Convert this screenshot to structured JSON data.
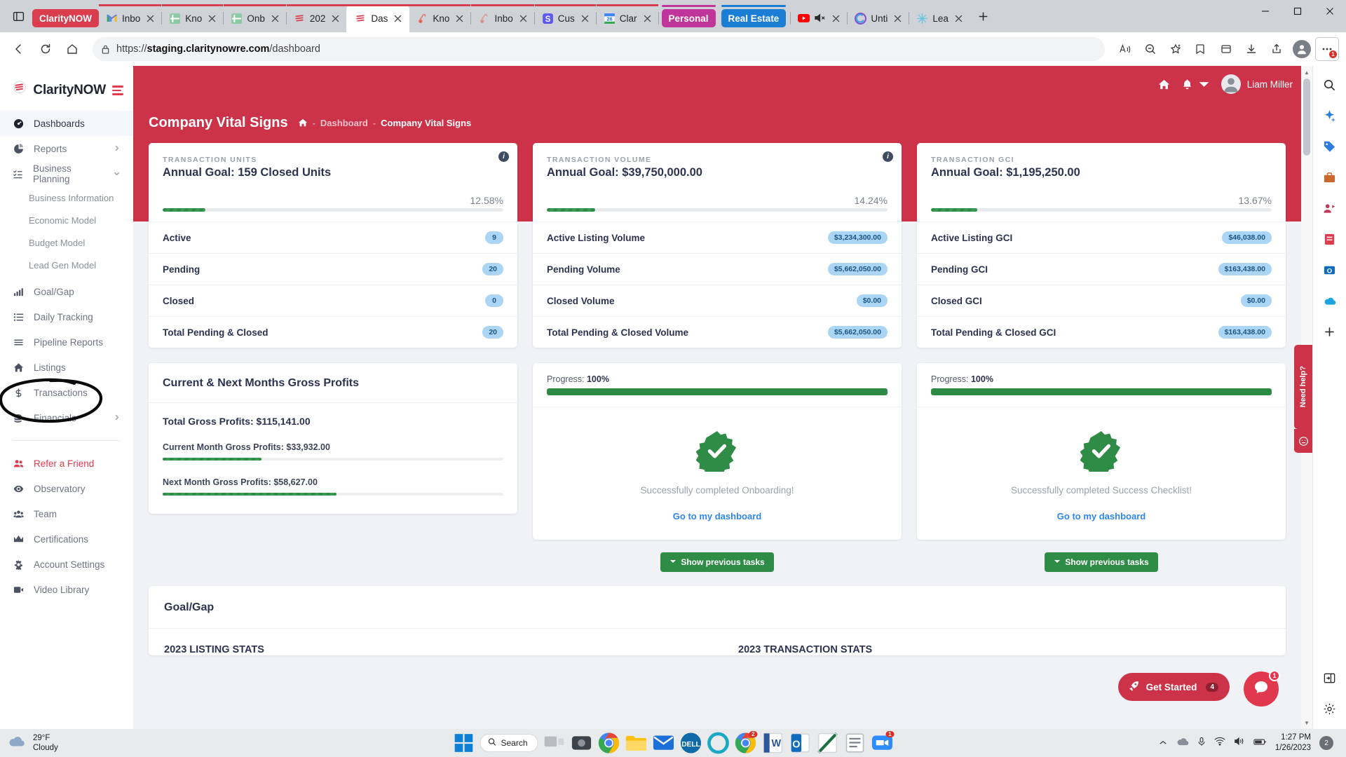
{
  "browser": {
    "tabs": [
      {
        "id": "claritynow-group",
        "label": "ClarityNOW",
        "type": "group-pill",
        "color": "#d93d4e"
      },
      {
        "id": "gmail",
        "label": "Inbo",
        "icon": "gmail-icon",
        "line": "#d93d4e"
      },
      {
        "id": "kno1",
        "label": "Kno",
        "icon": "sheets-icon",
        "line": "#d93d4e"
      },
      {
        "id": "onb",
        "label": "Onb",
        "icon": "sheets-icon",
        "line": "#d93d4e"
      },
      {
        "id": "2023",
        "label": "202",
        "icon": "claritynow-icon",
        "line": "#d93d4e"
      },
      {
        "id": "dashboard",
        "label": "Das",
        "icon": "claritynow-icon",
        "active": true,
        "line": "#d93d4e"
      },
      {
        "id": "kno2",
        "label": "Kno",
        "icon": "pipedrive-icon",
        "line": "#d93d4e"
      },
      {
        "id": "inbox2",
        "label": "Inbo",
        "icon": "pipedrive-icon",
        "line": "#d93d4e"
      },
      {
        "id": "cus",
        "label": "Cus",
        "icon": "s-icon",
        "line": "#d93d4e"
      },
      {
        "id": "clar",
        "label": "Clar",
        "icon": "calendar-26-icon",
        "line": "#d93d4e"
      },
      {
        "id": "personal",
        "label": "Personal",
        "type": "group-pill",
        "color": "#c0359a"
      },
      {
        "id": "realestate",
        "label": "Real Estate",
        "type": "group-pill",
        "color": "#1a7fd4"
      },
      {
        "id": "youtube",
        "label": "",
        "icon": "youtube-icon",
        "muted": true
      },
      {
        "id": "unti",
        "label": "Unti",
        "icon": "copilot-icon"
      },
      {
        "id": "lea",
        "label": "Lea",
        "icon": "sparkle-icon"
      }
    ],
    "new_tab_label": "+",
    "address": {
      "url_prefix": "https://",
      "url_domain": "staging.claritynowre.com",
      "url_path": "/dashboard"
    },
    "toolbar_icons": [
      "back-icon",
      "refresh-icon",
      "home-icon",
      "lock-icon",
      "read-aloud-icon",
      "zoom-out-icon",
      "collections-add-icon",
      "favorites-icon",
      "collections-icon",
      "downloads-icon",
      "share-icon",
      "profile-icon",
      "settings-more-icon"
    ],
    "more_badge": "1",
    "window_controls": [
      "minimize-icon",
      "maximize-icon",
      "close-icon"
    ]
  },
  "sidebar": {
    "brand": "ClarityNOW",
    "items": [
      {
        "label": "Dashboards",
        "icon": "dashboard-icon",
        "active": true
      },
      {
        "label": "Reports",
        "icon": "pie-chart-icon",
        "chevron": true
      },
      {
        "label": "Business Planning",
        "icon": "list-check-icon",
        "chevron": true,
        "expanded": true
      },
      {
        "label": "Business Information",
        "sub": true
      },
      {
        "label": "Economic Model",
        "sub": true
      },
      {
        "label": "Budget Model",
        "sub": true
      },
      {
        "label": "Lead Gen Model",
        "sub": true
      },
      {
        "label": "Goal/Gap",
        "icon": "bar-chart-icon"
      },
      {
        "label": "Daily Tracking",
        "icon": "list-icon"
      },
      {
        "label": "Pipeline Reports",
        "icon": "lines-icon"
      },
      {
        "label": "Listings",
        "icon": "home-icon",
        "annotated": true
      },
      {
        "label": "Transactions",
        "icon": "dollar-icon"
      },
      {
        "label": "Financials",
        "icon": "coins-icon",
        "chevron": true
      },
      {
        "label": "Refer a Friend",
        "icon": "people-icon",
        "accent": true
      },
      {
        "label": "Observatory",
        "icon": "eye-icon"
      },
      {
        "label": "Team",
        "icon": "team-icon"
      },
      {
        "label": "Certifications",
        "icon": "crown-icon"
      },
      {
        "label": "Account Settings",
        "icon": "gear-icon"
      },
      {
        "label": "Video Library",
        "icon": "video-icon"
      }
    ]
  },
  "topbar": {
    "home_icon": "home-icon",
    "bell_icon": "bell-icon",
    "user_name": "Liam Miller",
    "avatar_icon": "user-avatar-icon"
  },
  "header": {
    "title": "Company Vital Signs",
    "breadcrumb_home_icon": "home-icon",
    "breadcrumb": [
      "Dashboard",
      "Company Vital Signs"
    ]
  },
  "vital_cards": [
    {
      "kicker": "TRANSACTION UNITS",
      "goal": "Annual Goal: 159 Closed Units",
      "percent": "12.58%",
      "percent_value": 12.58,
      "info_icon": "info-icon",
      "rows": [
        {
          "label": "Active",
          "value": "9"
        },
        {
          "label": "Pending",
          "value": "20"
        },
        {
          "label": "Closed",
          "value": "0"
        },
        {
          "label": "Total Pending & Closed",
          "value": "20"
        }
      ]
    },
    {
      "kicker": "TRANSACTION VOLUME",
      "goal": "Annual Goal: $39,750,000.00",
      "percent": "14.24%",
      "percent_value": 14.24,
      "info_icon": "info-icon",
      "rows": [
        {
          "label": "Active Listing Volume",
          "value": "$3,234,300.00"
        },
        {
          "label": "Pending Volume",
          "value": "$5,662,050.00"
        },
        {
          "label": "Closed Volume",
          "value": "$0.00"
        },
        {
          "label": "Total Pending & Closed Volume",
          "value": "$5,662,050.00"
        }
      ]
    },
    {
      "kicker": "TRANSACTION GCI",
      "goal": "Annual Goal: $1,195,250.00",
      "percent": "13.67%",
      "percent_value": 13.67,
      "rows": [
        {
          "label": "Active Listing GCI",
          "value": "$46,038.00"
        },
        {
          "label": "Pending GCI",
          "value": "$163,438.00"
        },
        {
          "label": "Closed GCI",
          "value": "$0.00"
        },
        {
          "label": "Total Pending & Closed GCI",
          "value": "$163,438.00"
        }
      ]
    }
  ],
  "gross_profits": {
    "title": "Current & Next Months Gross Profits",
    "total": "Total Gross Profits: $115,141.00",
    "current": {
      "label": "Current Month Gross Profits: $33,932.00",
      "percent": 29
    },
    "next": {
      "label": "Next Month Gross Profits: $58,627.00",
      "percent": 51
    }
  },
  "onboarding": {
    "progress_label": "Progress:",
    "progress_value": "100%",
    "progress_percent": 100,
    "success_text": "Successfully completed Onboarding!",
    "link": "Go to my dashboard",
    "show_previous": "Show previous tasks",
    "badge_icon": "verified-check-icon",
    "chevron_icon": "chevron-down-icon"
  },
  "success_checklist": {
    "progress_label": "Progress:",
    "progress_value": "100%",
    "progress_percent": 100,
    "success_text": "Successfully completed Success Checklist!",
    "link": "Go to my dashboard",
    "show_previous": "Show previous tasks",
    "badge_icon": "verified-check-icon",
    "chevron_icon": "chevron-down-icon"
  },
  "goalgap": {
    "title": "Goal/Gap",
    "left_heading": "2023 LISTING STATS",
    "right_heading": "2023 TRANSACTION STATS"
  },
  "need_help": {
    "label": "Need help?",
    "icon": "help-face-icon"
  },
  "floating": {
    "get_started_label": "Get Started",
    "get_started_count": "4",
    "get_started_icon": "rocket-icon",
    "chat_icon": "chat-bubble-icon",
    "chat_badge": "1"
  },
  "taskbar": {
    "weather_temp": "29°F",
    "weather_desc": "Cloudy",
    "weather_icon": "cloud-icon",
    "search_label": "Search",
    "search_icon": "search-icon",
    "apps": [
      {
        "name": "start-icon"
      },
      {
        "name": "search-pill"
      },
      {
        "name": "task-view-icon"
      },
      {
        "name": "webcam-icon"
      },
      {
        "name": "chrome-icon"
      },
      {
        "name": "file-explorer-icon"
      },
      {
        "name": "mail-icon"
      },
      {
        "name": "dell-icon"
      },
      {
        "name": "ring-icon"
      },
      {
        "name": "chrome-apps-icon",
        "badge": "2"
      },
      {
        "name": "word-icon"
      },
      {
        "name": "outlook-icon"
      },
      {
        "name": "excel-icon"
      },
      {
        "name": "notes-icon"
      },
      {
        "name": "zoom-icon",
        "badge": "1"
      }
    ],
    "tray": [
      "chevron-up-icon",
      "onedrive-icon",
      "mic-icon",
      "wifi-icon",
      "volume-icon",
      "battery-icon"
    ],
    "time": "1:27 PM",
    "date": "1/26/2023",
    "notification_count": "2"
  }
}
